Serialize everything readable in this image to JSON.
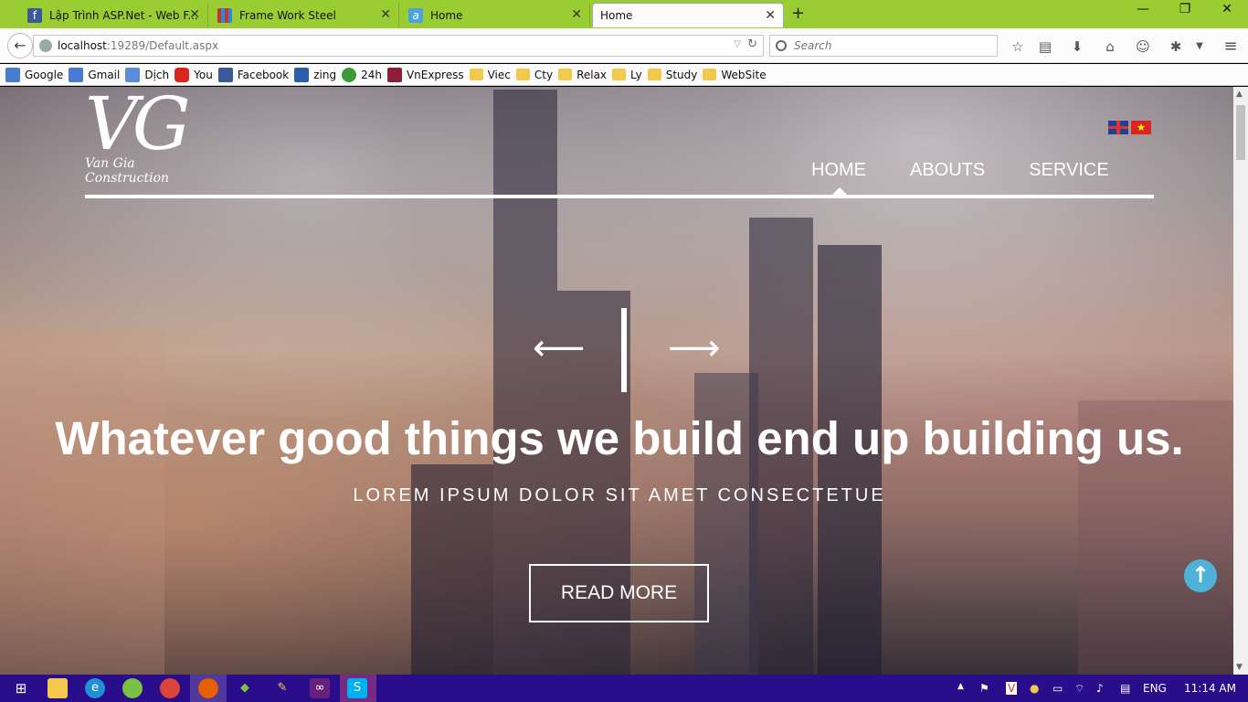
{
  "browser": {
    "tabs": [
      {
        "title": "Lập Trình ASP.Net - Web F...",
        "favicon": "facebook-favicon",
        "color": "#3b5998"
      },
      {
        "title": "Frame Work Steel",
        "favicon": "grid-favicon",
        "color": "#c0392b"
      },
      {
        "title": "Home",
        "favicon": "a-favicon",
        "color": "#4aa3df"
      },
      {
        "title": "Home",
        "favicon": "none",
        "active": true
      }
    ],
    "url_host": "localhost",
    "url_path": ":19289/Default.aspx",
    "search_placeholder": "Search",
    "bookmarks": [
      {
        "label": "Google",
        "icon": "google-icon",
        "color": "#4a7bd0"
      },
      {
        "label": "Gmail",
        "icon": "gmail-icon",
        "color": "#4a7bd0"
      },
      {
        "label": "Dịch",
        "icon": "translate-icon",
        "color": "#5b8dd8"
      },
      {
        "label": "You",
        "icon": "youtube-icon",
        "color": "#d9261c"
      },
      {
        "label": "Facebook",
        "icon": "facebook-icon",
        "color": "#3b5998"
      },
      {
        "label": "zing",
        "icon": "zing-icon",
        "color": "#2b5fa8"
      },
      {
        "label": "24h",
        "icon": "clock-icon",
        "color": "#3a9a3a"
      },
      {
        "label": "VnExpress",
        "icon": "vnexpress-icon",
        "color": "#8b1f3a"
      },
      {
        "label": "Viec",
        "icon": "folder-icon"
      },
      {
        "label": "Cty",
        "icon": "folder-icon"
      },
      {
        "label": "Relax",
        "icon": "folder-icon"
      },
      {
        "label": "Ly",
        "icon": "folder-icon"
      },
      {
        "label": "Study",
        "icon": "folder-icon"
      },
      {
        "label": "WebSite",
        "icon": "folder-icon"
      }
    ]
  },
  "site": {
    "logo_mono": "VG",
    "logo_tagline": "Van Gia Construction",
    "menu": [
      "HOME",
      "ABOUTS",
      "SERVICE"
    ],
    "headline": "Whatever good things we build end up building us.",
    "subline": "LOREM IPSUM DOLOR SIT AMET CONSECTETUE",
    "cta": "READ MORE"
  },
  "taskbar": {
    "language": "ENG",
    "time": "11:14 AM",
    "color": "#2a0d8a"
  }
}
